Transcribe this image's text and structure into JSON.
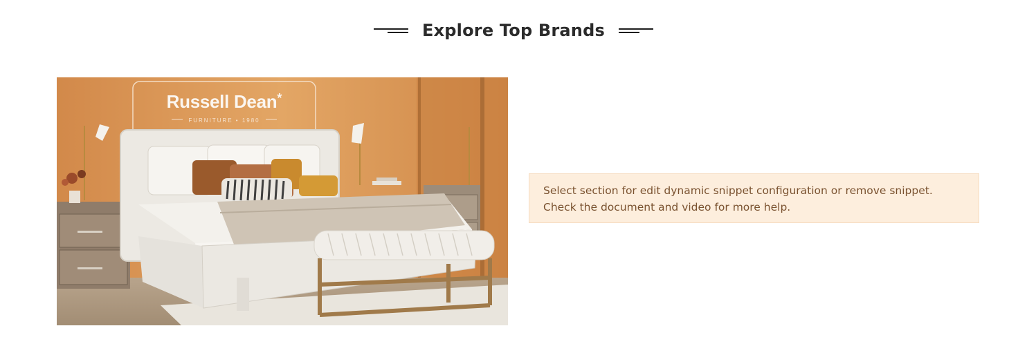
{
  "section": {
    "title": "Explore Top Brands"
  },
  "brand_banner": {
    "brand_name": "Russell Dean",
    "brand_mark": "*",
    "brand_tagline": "FURNITURE • 1980"
  },
  "snippet_alert": {
    "line1": "Select section for edit dynamic snippet configuration or remove snippet.",
    "line2": "Check the document and video for more help."
  },
  "colors": {
    "alert_background": "#fdeedd",
    "alert_text": "#7a5230",
    "wall": "#d99a58"
  }
}
